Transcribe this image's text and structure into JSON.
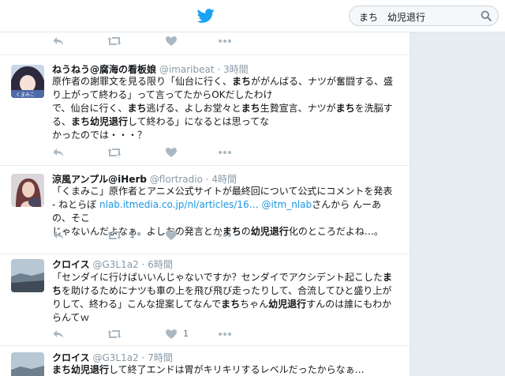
{
  "search": {
    "query": "まち　幼児退行"
  },
  "tweets": [
    {
      "name": "ねうねう@腐海の看板娘",
      "handle": "@imaribeat",
      "time": "3時間",
      "lines": [
        "原作者の謝罪文を見る限り「仙台に行く、<b>まち</b>ががんばる、ナツが奮闘する、盛",
        "り上がって終わる」って言ってたからOKだしたわけ",
        "で、仙台に行く、<b>まち</b>逃げる、よしお堂々と<b>まち</b>生贄宣言、ナツが<b>まち</b>を洗脳す",
        "る、<b>まち幼児退行</b>して終わる」になるとは思ってな",
        "かったのでは・・・？"
      ],
      "retweets": "",
      "likes": ""
    },
    {
      "name": "涼風アンプル@iHerb",
      "handle": "@flortradio",
      "time": "4時間",
      "lines": [
        "「くまみこ」原作者とアニメ公式サイトが最終回について公式にコメントを発表",
        "- ねとらぼ <span class=\"link\">nlab.itmedia.co.jp/nl/articles/16…</span> <span class=\"link\">@itm_nlab</span>さんから んーあの、そこ",
        "じゃないんだよなぁ。よしおの発言とか<b>まち</b>の<b>幼児退行</b>化のところだよね…。"
      ],
      "retweets": "1",
      "likes": ""
    },
    {
      "name": "クロイス",
      "handle": "@G3L1a2",
      "time": "6時間",
      "lines": [
        "「センダイに行けばいいんじゃないですか？センダイでアクシデント起こした<b>ま</b>",
        "<b>ち</b>を助けるためにナツも車の上を飛び飛び走ったりして、合流してひと盛り上が",
        "りして、終わる」こんな提案してなんで<b>まち</b>ちゃん<b>幼児退行</b>すんのは誰にもわか",
        "らんてｗ"
      ],
      "retweets": "",
      "likes": "1"
    },
    {
      "name": "クロイス",
      "handle": "@G3L1a2",
      "time": "7時間",
      "lines": [
        "<b>まち幼児退行</b>して終了エンドは胃がキリキリするレベルだったからなぁ…"
      ],
      "retweets": "",
      "likes": ""
    }
  ],
  "colors": {
    "brand": "#1da1f2",
    "icon": "#aab8c2",
    "link": "#1b95e0"
  }
}
